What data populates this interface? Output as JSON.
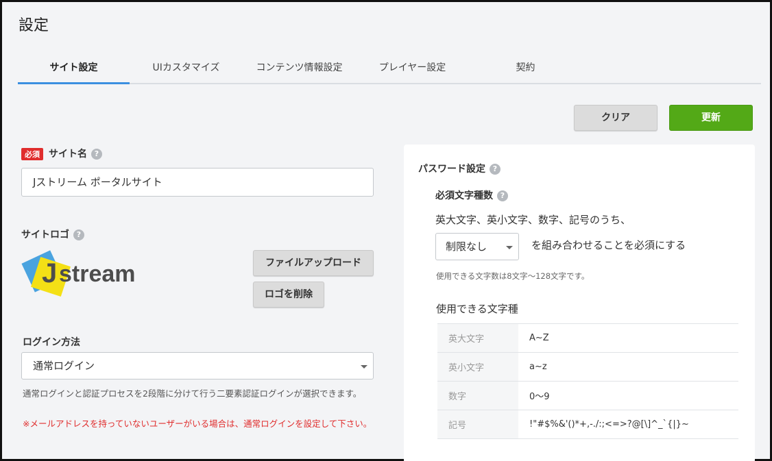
{
  "page": {
    "title": "設定"
  },
  "tabs": [
    {
      "label": "サイト設定",
      "active": true
    },
    {
      "label": "UIカスタマイズ"
    },
    {
      "label": "コンテンツ情報設定"
    },
    {
      "label": "プレイヤー設定"
    },
    {
      "label": "契約"
    }
  ],
  "actions": {
    "clear_label": "クリア",
    "update_label": "更新"
  },
  "site_name": {
    "required_badge": "必須",
    "label": "サイト名",
    "help": "?",
    "value": "Jストリーム ポータルサイト"
  },
  "site_logo": {
    "label": "サイトロゴ",
    "help": "?",
    "logo_letter": "J",
    "logo_text": "stream",
    "upload_label": "ファイルアップロード",
    "delete_label": "ロゴを削除"
  },
  "login": {
    "label": "ログイン方法",
    "selected": "通常ログイン",
    "hint": "通常ログインと認証プロセスを2段階に分けて行う二要素認証ログインが選択できます。",
    "warning": "※メールアドレスを持っていないユーザーがいる場合は、通常ログインを設定して下さい。"
  },
  "password": {
    "label": "パスワード設定",
    "help": "?",
    "required_types_label": "必須文字種数",
    "required_types_help": "?",
    "sentence_prefix": "英大文字、英小文字、数字、記号のうち、",
    "select_value": "制限なし",
    "sentence_suffix": "を組み合わせることを必須にする",
    "length_note": "使用できる文字数は8文字〜128文字です。",
    "allowed_heading": "使用できる文字種",
    "allowed": [
      {
        "type": "英大文字",
        "chars": "A~Z"
      },
      {
        "type": "英小文字",
        "chars": "a~z"
      },
      {
        "type": "数字",
        "chars": "0〜9"
      },
      {
        "type": "記号",
        "chars": "!\"#$%&'()*+,-./:;<=>?@[\\]^_`{|}~"
      }
    ]
  },
  "colors": {
    "accent": "#3b8fe0",
    "primary_button": "#53a917",
    "required": "#e02d2d",
    "logo_blue": "#4aa3df",
    "logo_yellow": "#f4e016",
    "logo_text": "#4d4d4d"
  }
}
